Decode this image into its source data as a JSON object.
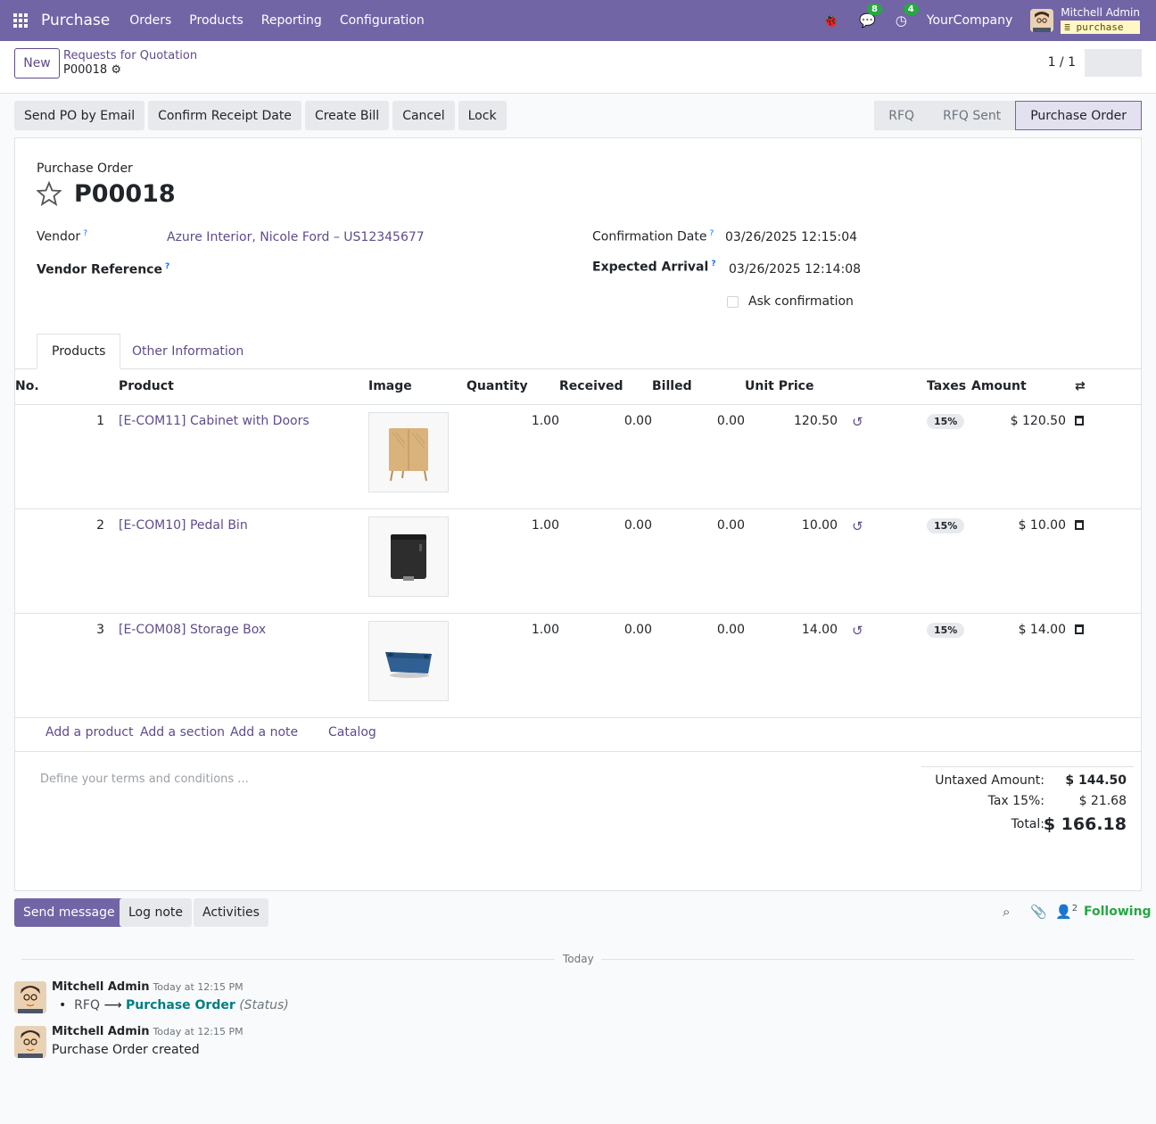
{
  "navbar": {
    "app_name": "Purchase",
    "menu": [
      "Orders",
      "Products",
      "Reporting",
      "Configuration"
    ],
    "messages_count": "8",
    "activities_count": "4",
    "company": "YourCompany",
    "user_name": "Mitchell Admin",
    "db_name": "purchase"
  },
  "control_panel": {
    "new_label": "New",
    "breadcrumb_parent": "Requests for Quotation",
    "breadcrumb_current": "P00018",
    "pager": "1 / 1"
  },
  "actions": {
    "send_po": "Send PO by Email",
    "confirm_receipt": "Confirm Receipt Date",
    "create_bill": "Create Bill",
    "cancel": "Cancel",
    "lock": "Lock"
  },
  "statusbar": [
    "RFQ",
    "RFQ Sent",
    "Purchase Order"
  ],
  "form": {
    "doc_type": "Purchase Order",
    "po_number": "P00018",
    "vendor_label": "Vendor",
    "vendor_value": "Azure Interior, Nicole Ford – US12345677",
    "vendor_ref_label": "Vendor Reference",
    "confirmation_date_label": "Confirmation Date",
    "confirmation_date_value": "03/26/2025 12:15:04",
    "expected_arrival_label": "Expected Arrival",
    "expected_arrival_value": "03/26/2025 12:14:08",
    "ask_confirmation_label": "Ask confirmation"
  },
  "tabs": [
    "Products",
    "Other Information"
  ],
  "columns": [
    "No.",
    "Product",
    "Image",
    "Quantity",
    "Received",
    "Billed",
    "Unit Price",
    "Taxes",
    "Amount"
  ],
  "lines": [
    {
      "no": "1",
      "product": "[E-COM11] Cabinet with Doors",
      "qty": "1.00",
      "received": "0.00",
      "billed": "0.00",
      "unit_price": "120.50",
      "tax": "15%",
      "amount": "$ 120.50"
    },
    {
      "no": "2",
      "product": "[E-COM10] Pedal Bin",
      "qty": "1.00",
      "received": "0.00",
      "billed": "0.00",
      "unit_price": "10.00",
      "tax": "15%",
      "amount": "$ 10.00"
    },
    {
      "no": "3",
      "product": "[E-COM08] Storage Box",
      "qty": "1.00",
      "received": "0.00",
      "billed": "0.00",
      "unit_price": "14.00",
      "tax": "15%",
      "amount": "$ 14.00"
    }
  ],
  "add_links": [
    "Add a product",
    "Add a section",
    "Add a note",
    "Catalog"
  ],
  "terms_placeholder": "Define your terms and conditions ...",
  "totals": {
    "untaxed_label": "Untaxed Amount:",
    "untaxed_value": "$ 144.50",
    "tax_label": "Tax 15%:",
    "tax_value": "$ 21.68",
    "total_label": "Total:",
    "total_value": "$ 166.18"
  },
  "chatter": {
    "send_message": "Send message",
    "log_note": "Log note",
    "activities": "Activities",
    "followers_count": "2",
    "following": "Following",
    "date_separator": "Today",
    "messages": [
      {
        "author": "Mitchell Admin",
        "time": "Today at 12:15 PM",
        "from": "RFQ",
        "to": "Purchase Order",
        "field": "(Status)"
      },
      {
        "author": "Mitchell Admin",
        "time": "Today at 12:15 PM",
        "body": "Purchase Order created"
      }
    ]
  }
}
